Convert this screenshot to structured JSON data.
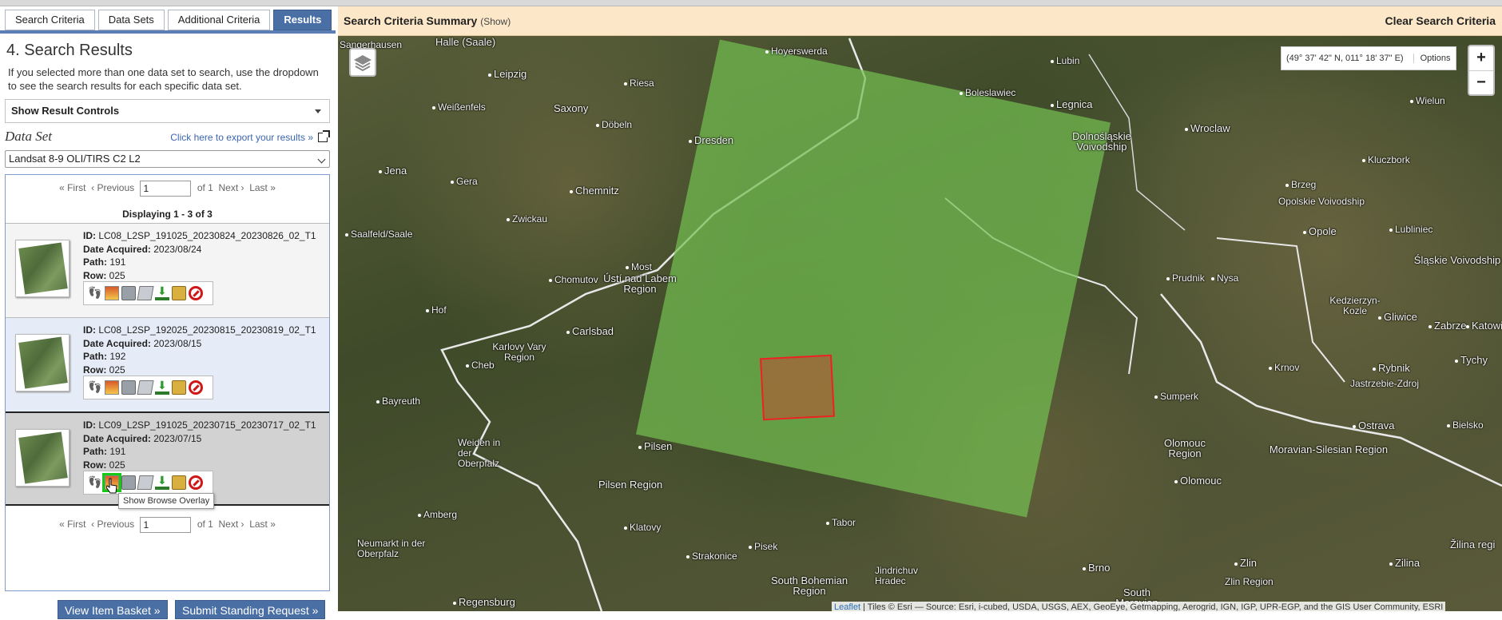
{
  "tabs": [
    {
      "label": "Search Criteria"
    },
    {
      "label": "Data Sets"
    },
    {
      "label": "Additional Criteria"
    },
    {
      "label": "Results"
    }
  ],
  "panel": {
    "title": "4. Search Results",
    "help": "If you selected more than one data set to search, use the dropdown to see the search results for each specific data set.",
    "show_controls": "Show Result Controls",
    "dataset_label": "Data Set",
    "export_link": "Click here to export your results »",
    "dataset_selected": "Landsat 8-9 OLI/TIRS C2 L2",
    "pager": {
      "first": "« First",
      "previous": "‹ Previous",
      "page": "1",
      "of": "of 1",
      "next": "Next ›",
      "last": "Last »"
    },
    "displaying": "Displaying 1 - 3 of 3",
    "results": [
      {
        "id_label": "ID:",
        "id": "LC08_L2SP_191025_20230824_20230826_02_T1",
        "date_label": "Date Acquired:",
        "date": "2023/08/24",
        "path_label": "Path:",
        "path": "191",
        "row_label": "Row:",
        "row": "025"
      },
      {
        "id_label": "ID:",
        "id": "LC08_L2SP_192025_20230815_20230819_02_T1",
        "date_label": "Date Acquired:",
        "date": "2023/08/15",
        "path_label": "Path:",
        "path": "192",
        "row_label": "Row:",
        "row": "025"
      },
      {
        "id_label": "ID:",
        "id": "LC09_L2SP_191025_20230715_20230717_02_T1",
        "date_label": "Date Acquired:",
        "date": "2023/07/15",
        "path_label": "Path:",
        "path": "191",
        "row_label": "Row:",
        "row": "025"
      }
    ],
    "tooltip": "Show Browse Overlay",
    "view_basket": "View Item Basket »",
    "submit_request": "Submit Standing Request »"
  },
  "map": {
    "summary_title": "Search Criteria Summary",
    "summary_show": "(Show)",
    "clear": "Clear Search Criteria",
    "coords": "(49° 37' 42\" N, 011° 18' 37\" E)",
    "options": "Options",
    "zoom_in": "+",
    "zoom_out": "−",
    "attribution_leaflet": "Leaflet",
    "attribution_text": "| Tiles © Esri — Source: Esri, i-cubed, USDA, USGS, AEX, GeoEye, Getmapping, Aerogrid, IGN, IGP, UPR-EGP, and the GIS User Community, ESRI",
    "places": [
      {
        "name": "Sangerhausen"
      },
      {
        "name": "Halle (Saale)"
      },
      {
        "name": "Hoyerswerda"
      },
      {
        "name": "Lubin"
      },
      {
        "name": "Leipzig"
      },
      {
        "name": "Riesa"
      },
      {
        "name": "Boleslawiec"
      },
      {
        "name": "Legnica"
      },
      {
        "name": "Weißenfels"
      },
      {
        "name": "Saxony"
      },
      {
        "name": "Wielun"
      },
      {
        "name": "Döbeln"
      },
      {
        "name": "Dolnośląskie Voivodship"
      },
      {
        "name": "Wroclaw"
      },
      {
        "name": "Dresden"
      },
      {
        "name": "Kluczbork"
      },
      {
        "name": "Jena"
      },
      {
        "name": "Gera"
      },
      {
        "name": "Brzeg"
      },
      {
        "name": "Chemnitz"
      },
      {
        "name": "Opolskie Voivodship"
      },
      {
        "name": "Zwickau"
      },
      {
        "name": "Saalfeld/Saale"
      },
      {
        "name": "Opole"
      },
      {
        "name": "Lubliniec"
      },
      {
        "name": "Most"
      },
      {
        "name": "Ústí nad Labem Region"
      },
      {
        "name": "Chomutov"
      },
      {
        "name": "Prudnik"
      },
      {
        "name": "Nysa"
      },
      {
        "name": "Śląskie Voivodship"
      },
      {
        "name": "Hof"
      },
      {
        "name": "Kedzierzyn-Kozle"
      },
      {
        "name": "Gliwice"
      },
      {
        "name": "Zabrze"
      },
      {
        "name": "Katowice"
      },
      {
        "name": "Carlsbad"
      },
      {
        "name": "Karlovy Vary Region"
      },
      {
        "name": "Cheb"
      },
      {
        "name": "Tychy"
      },
      {
        "name": "Krnov"
      },
      {
        "name": "Rybnik"
      },
      {
        "name": "Jastrzebie-Zdroj"
      },
      {
        "name": "Bayreuth"
      },
      {
        "name": "Sumperk"
      },
      {
        "name": "Ostrava"
      },
      {
        "name": "Bielsko"
      },
      {
        "name": "Weiden in der Oberpfalz"
      },
      {
        "name": "Pilsen"
      },
      {
        "name": "Olomouc Region"
      },
      {
        "name": "Moravian-Silesian Region"
      },
      {
        "name": "Pilsen Region"
      },
      {
        "name": "Olomouc"
      },
      {
        "name": "Amberg"
      },
      {
        "name": "Klatovy"
      },
      {
        "name": "Tabor"
      },
      {
        "name": "Neumarkt in der Oberpfalz"
      },
      {
        "name": "Strakonice"
      },
      {
        "name": "Pisek"
      },
      {
        "name": "Jindrichuv Hradec"
      },
      {
        "name": "Zlin"
      },
      {
        "name": "Zilina"
      },
      {
        "name": "Zlin Region"
      },
      {
        "name": "Žilina regi"
      },
      {
        "name": "Brno"
      },
      {
        "name": "South Bohemian Region"
      },
      {
        "name": "South Moravian"
      },
      {
        "name": "Regensburg"
      }
    ]
  }
}
